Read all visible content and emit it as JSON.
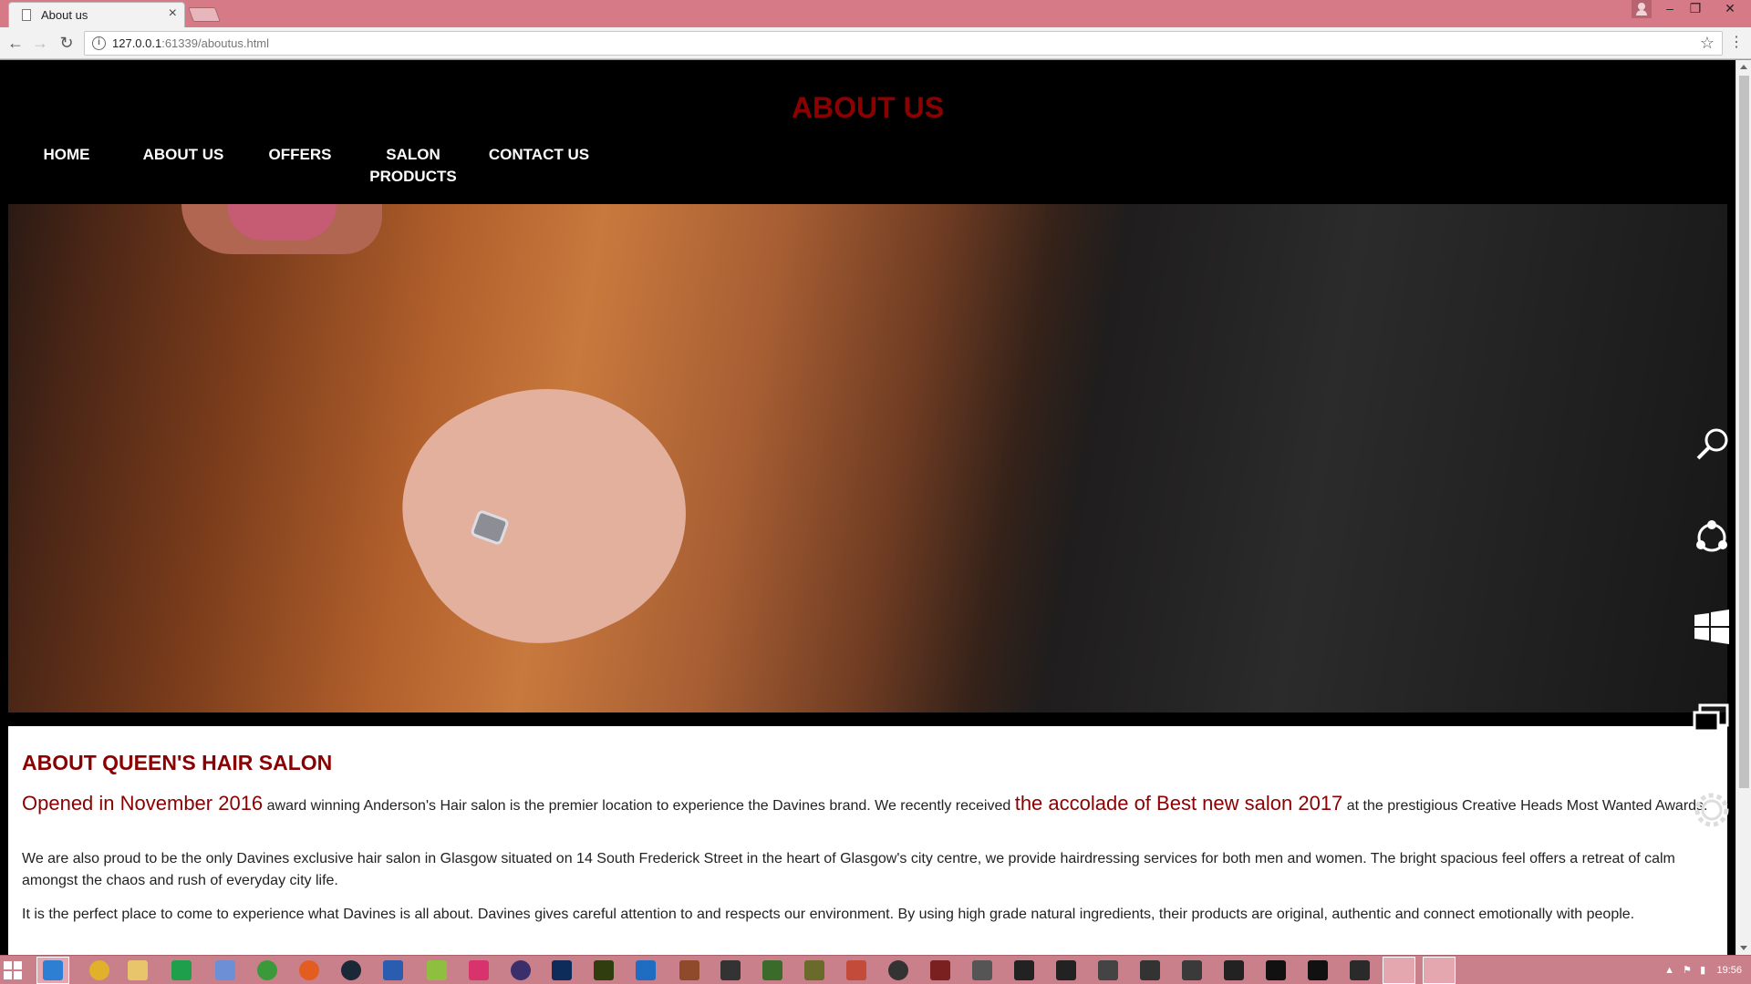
{
  "browser": {
    "tab_title": "About us",
    "tab_close": "×",
    "url_host": "127.0.0.1",
    "url_rest": ":61339/aboutus.html",
    "window_controls": [
      "‒",
      "❐",
      "✕"
    ]
  },
  "site": {
    "title": "ABOUT US",
    "nav": [
      {
        "label": "HOME"
      },
      {
        "label": "ABOUT US"
      },
      {
        "label": "OFFERS"
      },
      {
        "label": "SALON PRODUCTS"
      },
      {
        "label": "CONTACT US"
      }
    ],
    "heading": "ABOUT QUEEN'S HAIR SALON",
    "para1": {
      "hl1": "Opened in November 2016",
      "t1": " award winning Anderson's Hair salon is the premier location to experience the Davines brand. We recently received ",
      "hl2": "the accolade of Best new salon 2017",
      "t2": " at the prestigious Creative Heads Most Wanted Awards."
    },
    "para2": "We are also proud to be the only Davines exclusive hair salon in Glasgow situated on 14 South Frederick Street in the heart of Glasgow's city centre, we provide hairdressing services for both men and women. The bright spacious feel offers a retreat of calm amongst the chaos and rush of everyday city life.",
    "para3": "It is the perfect place to come to experience what Davines is all about. Davines gives careful attention to and respects our environment. By using high grade natural ingredients, their products are original, authentic and connect emotionally with people."
  },
  "colors": {
    "accent": "#8b0000",
    "titlebar": "#d67a87",
    "taskbar": "#c9808a"
  },
  "charms": [
    "search-icon",
    "share-icon",
    "windows-start-icon",
    "devices-icon",
    "settings-icon"
  ],
  "taskbar": {
    "clock": "19:56"
  }
}
